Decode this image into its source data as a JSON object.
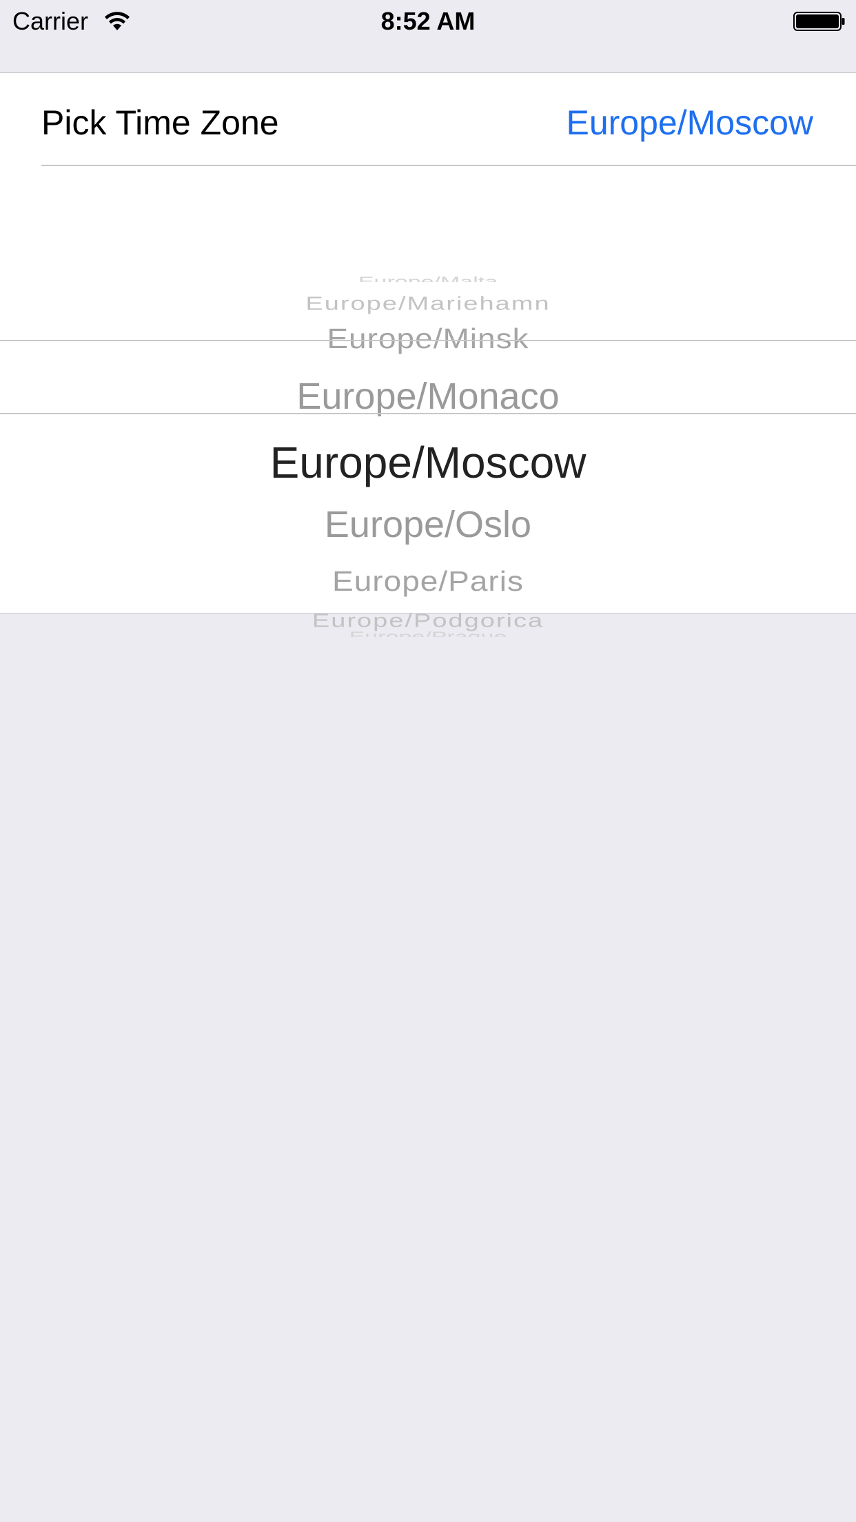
{
  "status_bar": {
    "carrier": "Carrier",
    "time": "8:52 AM",
    "wifi_icon": "wifi-icon",
    "battery_icon": "battery-full-icon"
  },
  "time_zone_row": {
    "label": "Pick Time Zone",
    "value": "Europe/Moscow"
  },
  "picker": {
    "items_above": [
      "Europe/Malta",
      "Europe/Mariehamn",
      "Europe/Minsk",
      "Europe/Monaco"
    ],
    "selected": "Europe/Moscow",
    "items_below": [
      "Europe/Oslo",
      "Europe/Paris",
      "Europe/Podgorica",
      "Europe/Prague"
    ]
  },
  "colors": {
    "accent": "#1e6ff0",
    "background": "#ebebf1",
    "separator": "#c8c7cc"
  }
}
